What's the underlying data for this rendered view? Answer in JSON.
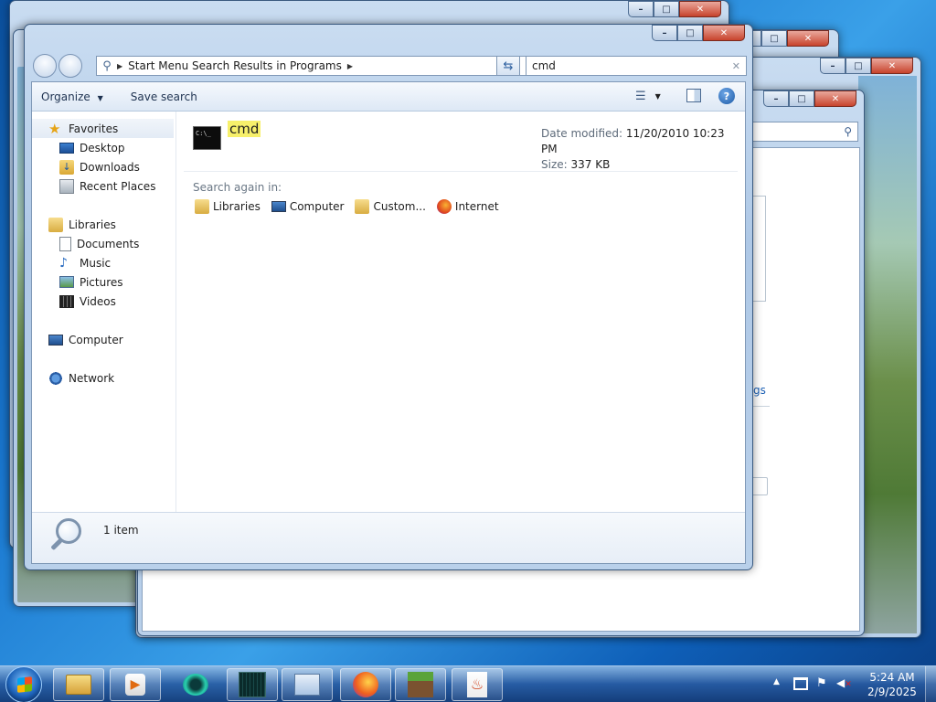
{
  "main_window": {
    "address_segments": [
      "Start Menu Search Results in Programs"
    ],
    "search_value": "cmd",
    "toolbar": {
      "organize_label": "Organize",
      "save_search_label": "Save search"
    },
    "nav": {
      "favorites": "Favorites",
      "favorites_items": [
        "Desktop",
        "Downloads",
        "Recent Places"
      ],
      "libraries": "Libraries",
      "libraries_items": [
        "Documents",
        "Music",
        "Pictures",
        "Videos"
      ],
      "computer": "Computer",
      "network": "Network"
    },
    "result": {
      "name": "cmd",
      "date_modified_label": "Date modified:",
      "date_modified_value": "11/20/2010 10:23 PM",
      "size_label": "Size:",
      "size_value": "337 KB",
      "icon_text": "C:\\_"
    },
    "search_again": {
      "label": "Search again in:",
      "locations": [
        "Libraries",
        "Computer",
        "Custom...",
        "Internet"
      ]
    },
    "details_pane": {
      "item_count": "1 item"
    }
  },
  "background_window": {
    "link_fragment": "gs"
  },
  "taskbar": {
    "clock_time": "5:24 AM",
    "clock_date": "2/9/2025",
    "pinned": [
      "explorer-icon",
      "media-player-icon",
      "app-icon",
      "terminal-icon",
      "control-panel-icon",
      "firefox-icon",
      "minecraft-icon",
      "java-icon"
    ]
  },
  "colors": {
    "highlight": "#f7f06b",
    "accent": "#1a78d0"
  }
}
